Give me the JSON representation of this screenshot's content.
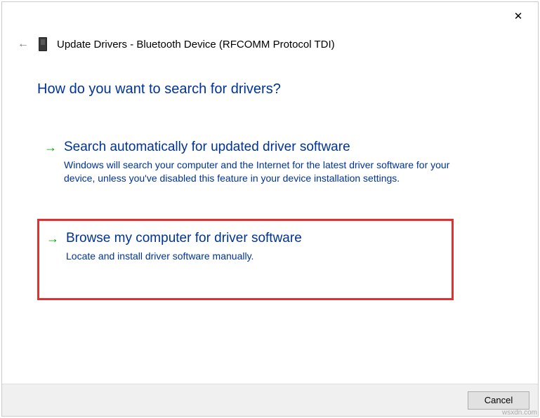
{
  "header": {
    "title": "Update Drivers - Bluetooth Device (RFCOMM Protocol TDI)"
  },
  "heading": "How do you want to search for drivers?",
  "options": {
    "search_auto": {
      "title": "Search automatically for updated driver software",
      "desc": "Windows will search your computer and the Internet for the latest driver software for your device, unless you've disabled this feature in your device installation settings."
    },
    "browse": {
      "title": "Browse my computer for driver software",
      "desc": "Locate and install driver software manually."
    }
  },
  "buttons": {
    "cancel": "Cancel"
  },
  "watermark": "wsxdn.com"
}
